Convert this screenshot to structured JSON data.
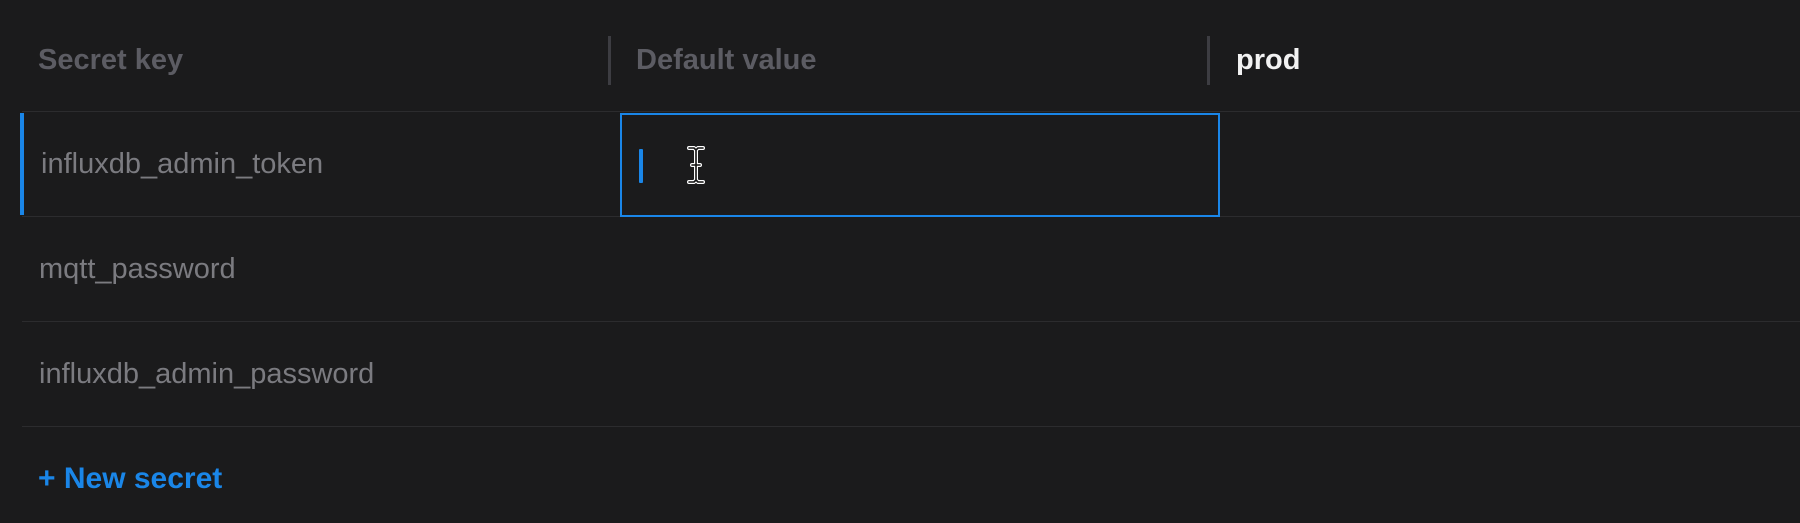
{
  "table": {
    "columns": [
      {
        "label": "Secret key",
        "active": false
      },
      {
        "label": "Default value",
        "active": false
      },
      {
        "label": "prod",
        "active": true
      }
    ],
    "rows": [
      {
        "key": "influxdb_admin_token",
        "default_value": "",
        "prod_value": "",
        "selected": true,
        "editing": true
      },
      {
        "key": "mqtt_password",
        "default_value": "",
        "prod_value": "",
        "selected": false,
        "editing": false
      },
      {
        "key": "influxdb_admin_password",
        "default_value": "",
        "prod_value": "",
        "selected": false,
        "editing": false
      }
    ]
  },
  "actions": {
    "new_secret_label": "+ New secret"
  },
  "colors": {
    "background": "#1b1b1c",
    "accent": "#1a86e8",
    "header_text": "#5c5c63",
    "header_active_text": "#f2f2f2",
    "row_text": "#7b7b80",
    "divider": "#2c2c2e"
  },
  "cursor": {
    "icon": "text-cursor-icon"
  }
}
